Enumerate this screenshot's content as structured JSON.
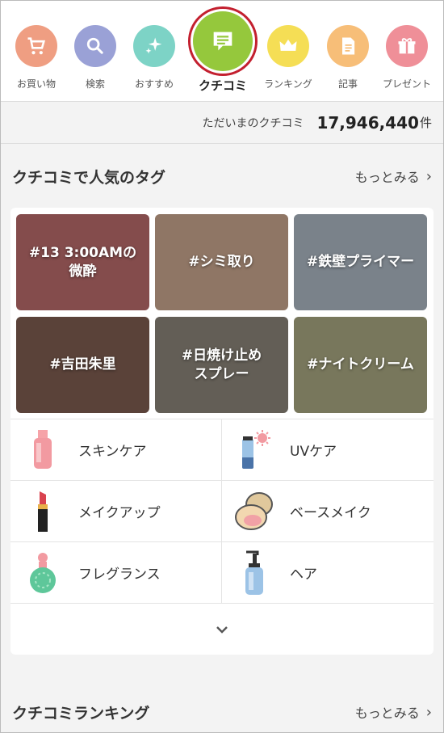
{
  "nav": {
    "items": [
      {
        "label": "お買い物",
        "color": "#ef9e82",
        "icon": "cart-icon"
      },
      {
        "label": "検索",
        "color": "#9aa1d6",
        "icon": "search-icon"
      },
      {
        "label": "おすすめ",
        "color": "#7dd3c6",
        "icon": "sparkle-icon"
      },
      {
        "label": "クチコミ",
        "color": "#95c83c",
        "icon": "chat-icon"
      },
      {
        "label": "ランキング",
        "color": "#f5de55",
        "icon": "crown-icon"
      },
      {
        "label": "記事",
        "color": "#f7be78",
        "icon": "document-icon"
      },
      {
        "label": "プレゼント",
        "color": "#ef8f98",
        "icon": "gift-icon"
      }
    ]
  },
  "count": {
    "label": "ただいまのクチコミ",
    "value": "17,946,440",
    "unit": "件"
  },
  "popular_tags": {
    "title": "クチコミで人気のタグ",
    "more": "もっとみる",
    "tags": [
      {
        "text": "#13 3:00AMの\n微酔",
        "color": "#b86a6a"
      },
      {
        "text": "#シミ取り",
        "color": "#c7a48c"
      },
      {
        "text": "#鉄壁プライマー",
        "color": "#a9b4c0"
      },
      {
        "text": "#吉田朱里",
        "color": "#7d5c50"
      },
      {
        "text": "#日焼け止め\nスプレー",
        "color": "#8a8378"
      },
      {
        "text": "#ナイトクリーム",
        "color": "#a7a580"
      }
    ]
  },
  "categories": [
    {
      "label": "スキンケア",
      "icon": "lotion-bottle-icon"
    },
    {
      "label": "UVケア",
      "icon": "sunscreen-icon"
    },
    {
      "label": "メイクアップ",
      "icon": "lipstick-icon"
    },
    {
      "label": "ベースメイク",
      "icon": "compact-icon"
    },
    {
      "label": "フレグランス",
      "icon": "perfume-icon"
    },
    {
      "label": "ヘア",
      "icon": "pump-bottle-icon"
    }
  ],
  "expand_icon": "chevron-down-icon",
  "ranking": {
    "title": "クチコミランキング",
    "more": "もっとみる"
  }
}
